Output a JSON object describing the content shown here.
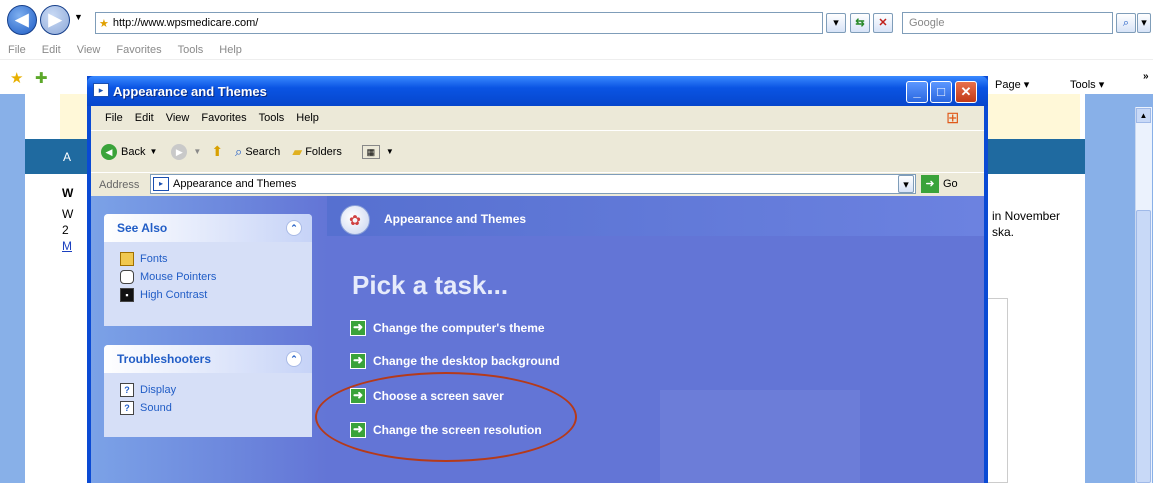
{
  "ie": {
    "url": "http://www.wpsmedicare.com/",
    "search_placeholder": "Google",
    "menu": [
      "File",
      "Edit",
      "View",
      "Favorites",
      "Tools",
      "Help"
    ],
    "page_label": "Page ▾",
    "tools_label": "Tools ▾"
  },
  "bg_page": {
    "a": "A",
    "w": "W",
    "line1": "W",
    "line2": "2",
    "line3": "M",
    "right1": "in November",
    "right2": "ska."
  },
  "window": {
    "title": "Appearance and Themes",
    "menu": [
      "File",
      "Edit",
      "View",
      "Favorites",
      "Tools",
      "Help"
    ],
    "toolbar": {
      "back": "Back",
      "search": "Search",
      "folders": "Folders"
    },
    "address_label": "Address",
    "address_value": "Appearance and Themes",
    "go": "Go"
  },
  "see_also": {
    "title": "See Also",
    "items": [
      "Fonts",
      "Mouse Pointers",
      "High Contrast"
    ]
  },
  "troubleshooters": {
    "title": "Troubleshooters",
    "items": [
      "Display",
      "Sound"
    ]
  },
  "main": {
    "header": "Appearance and Themes",
    "pick": "Pick a task...",
    "tasks": [
      "Change the computer's theme",
      "Change the desktop background",
      "Choose a screen saver",
      "Change the screen resolution"
    ]
  }
}
